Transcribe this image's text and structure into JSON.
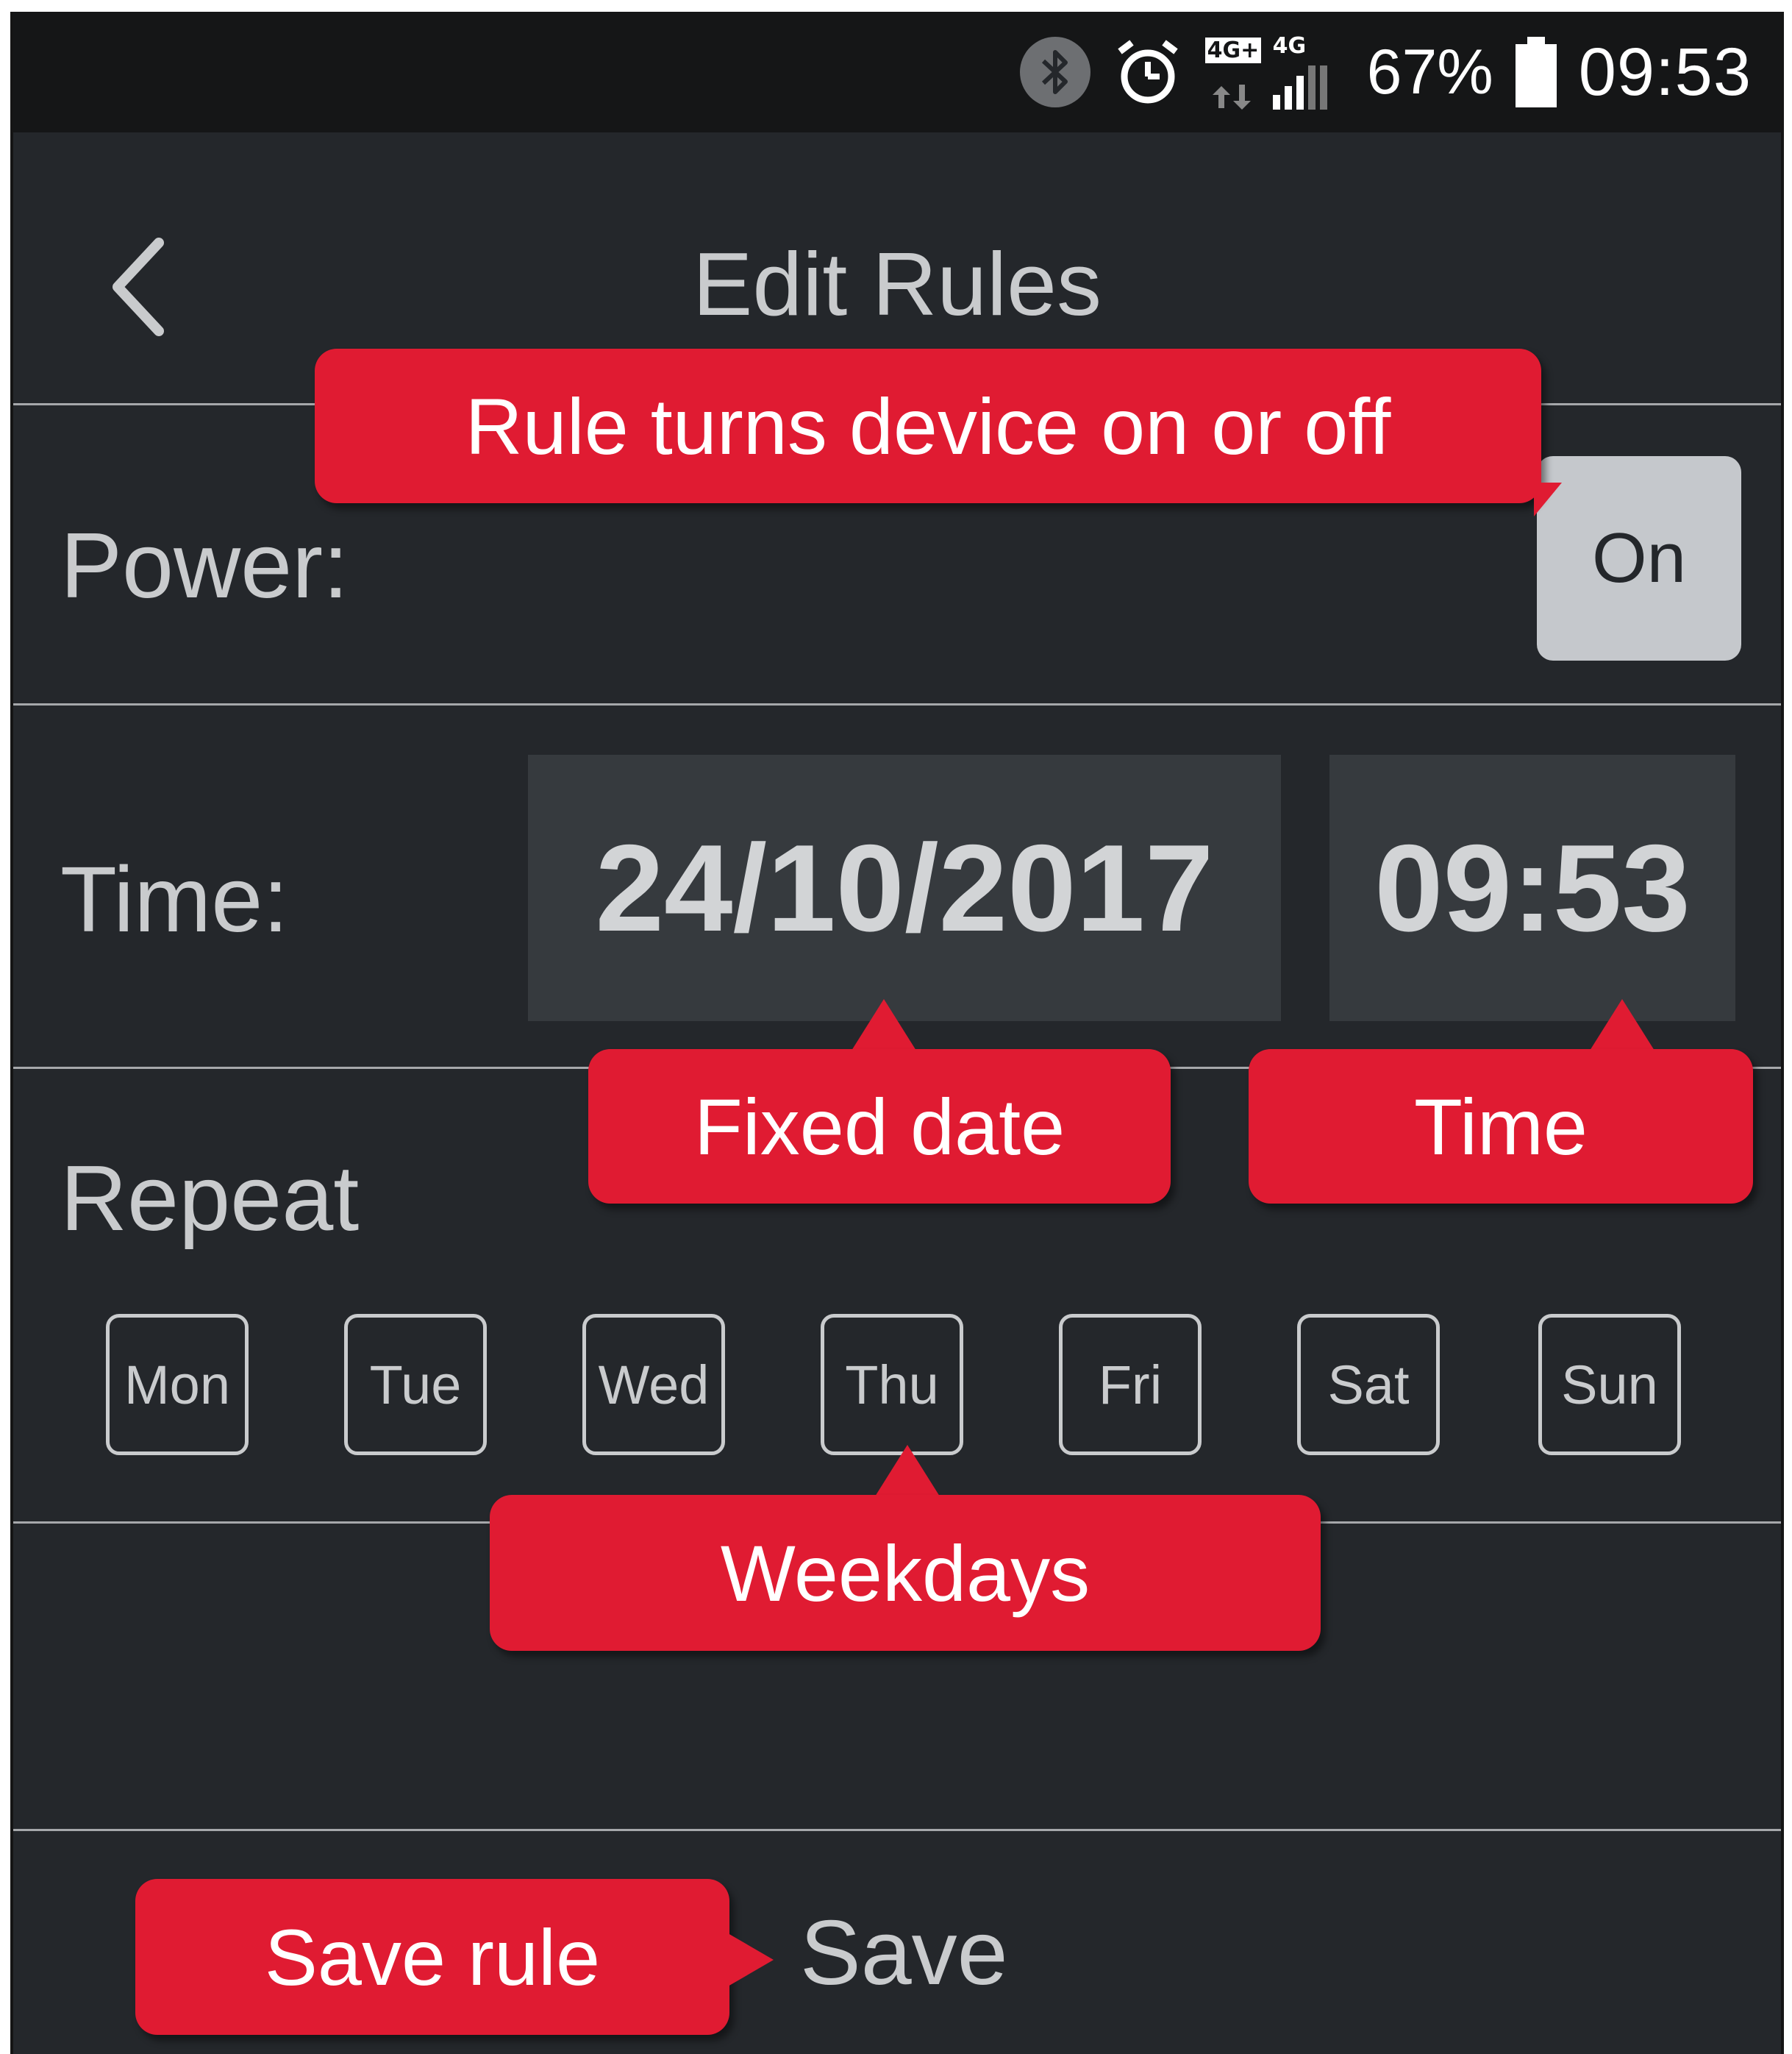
{
  "status_bar": {
    "network_primary": "4G+",
    "network_secondary": "4G",
    "battery_percent": "67%",
    "time": "09:53",
    "icons": [
      "bluetooth-icon",
      "alarm-icon",
      "network-icon",
      "signal-icon",
      "battery-icon"
    ]
  },
  "header": {
    "title": "Edit Rules",
    "back_icon": "chevron-left-icon"
  },
  "power": {
    "label": "Power:",
    "value": "On"
  },
  "time_row": {
    "label": "Time:",
    "date": "24/10/2017",
    "time": "09:53"
  },
  "repeat": {
    "label": "Repeat",
    "days": [
      "Mon",
      "Tue",
      "Wed",
      "Thu",
      "Fri",
      "Sat",
      "Sun"
    ]
  },
  "footer": {
    "save_label": "Save"
  },
  "callouts": {
    "power": "Rule turns device on or off",
    "date": "Fixed date",
    "time": "Time",
    "weekdays": "Weekdays",
    "save": "Save rule"
  },
  "colors": {
    "background": "#24272b",
    "status_bar": "#151617",
    "callout": "#e01b32",
    "text": "#c9cbcd",
    "field": "#363a3e",
    "toggle": "#c5c8cc"
  }
}
